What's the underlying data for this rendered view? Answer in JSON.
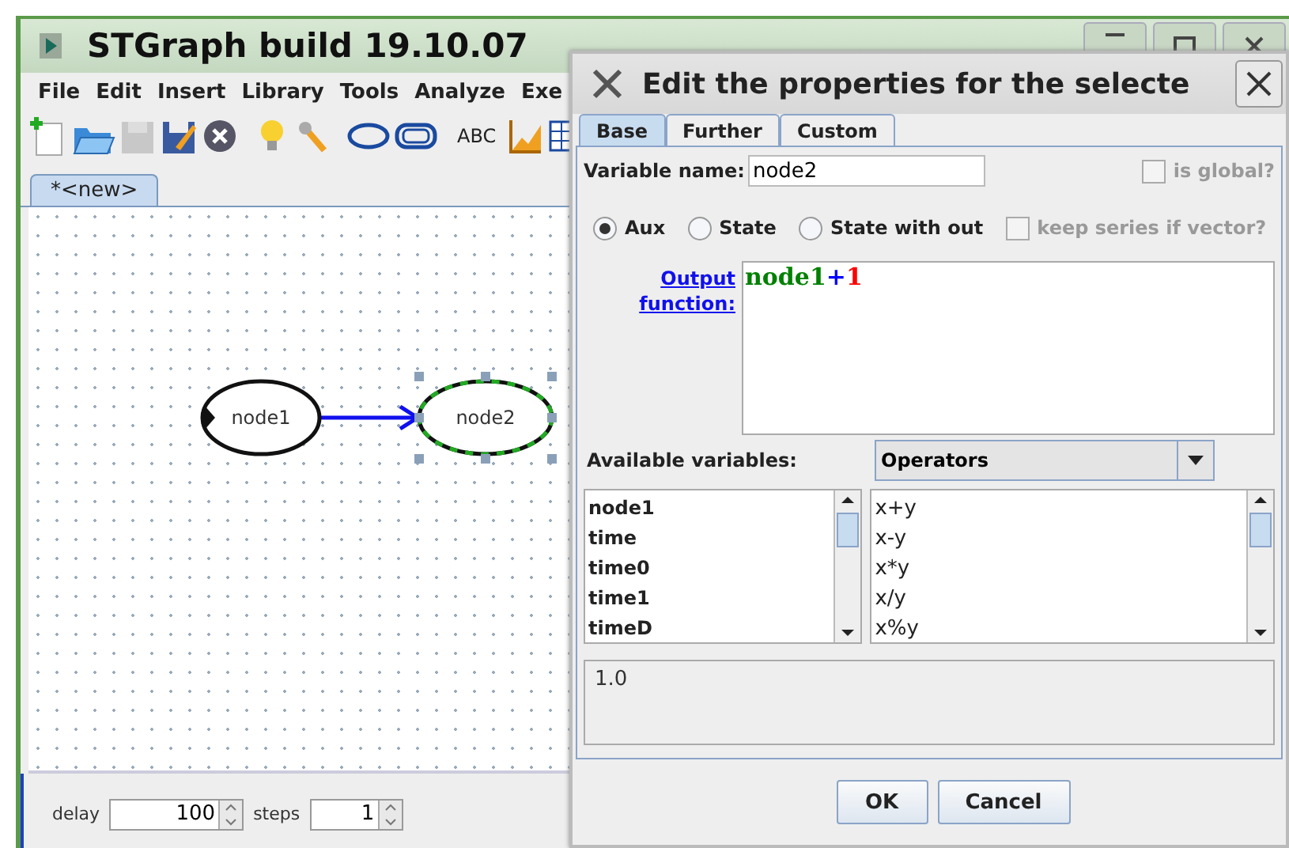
{
  "main_window": {
    "title": "STGraph build 19.10.07"
  },
  "menu": [
    {
      "label": "File"
    },
    {
      "label": "Edit"
    },
    {
      "label": "Insert"
    },
    {
      "label": "Library"
    },
    {
      "label": "Tools"
    },
    {
      "label": "Analyze"
    },
    {
      "label": "Exe"
    }
  ],
  "toolbar": [
    {
      "kind": "new"
    },
    {
      "kind": "open"
    },
    {
      "kind": "save",
      "disabled": true
    },
    {
      "kind": "save-as",
      "disabled": false
    },
    {
      "kind": "close"
    },
    {
      "kind": "bulb"
    },
    {
      "kind": "wrench"
    },
    {
      "kind": "ellipse"
    },
    {
      "kind": "roundrect"
    },
    {
      "kind": "text",
      "label": "ABC"
    },
    {
      "kind": "chart"
    },
    {
      "kind": "table"
    }
  ],
  "document_tabs": [
    {
      "label": "*<new>",
      "selected": true
    }
  ],
  "diagram": {
    "nodes": [
      {
        "label": "node1",
        "kind": "input",
        "selected": false
      },
      {
        "label": "node2",
        "kind": "plain",
        "selected": true
      }
    ]
  },
  "run_controls": {
    "delay_label": "delay",
    "delay": "100",
    "steps_label": "steps",
    "steps": "1"
  },
  "dialog": {
    "title": "Edit the properties for the selecte",
    "tabs": [
      {
        "label": "Base",
        "selected": true
      },
      {
        "label": "Further",
        "selected": false
      },
      {
        "label": "Custom",
        "selected": false
      }
    ],
    "variable_name_label": "Variable name:",
    "variable_name": "node2",
    "is_global": {
      "label": "is global?",
      "checked": false,
      "disabled": true
    },
    "types": [
      {
        "label": "Aux",
        "selected": true
      },
      {
        "label": "State",
        "selected": false
      },
      {
        "label": "State with out",
        "selected": false
      }
    ],
    "keep_series": {
      "label": "keep series if vector?",
      "checked": false,
      "disabled": true
    },
    "output_function_label": "Output function:",
    "expression": [
      {
        "text": "node1",
        "color": "#008000"
      },
      {
        "text": "+",
        "color": "#0000ff"
      },
      {
        "text": "1",
        "color": "#ff0000"
      }
    ],
    "available_label": "Available variables:",
    "category": "Operators",
    "variables": [
      "node1",
      "time",
      "time0",
      "time1",
      "timeD"
    ],
    "operators": [
      "x+y",
      "x-y",
      "x*y",
      "x/y",
      "x%y"
    ],
    "description": "1.0",
    "buttons": [
      "OK",
      "Cancel"
    ]
  }
}
